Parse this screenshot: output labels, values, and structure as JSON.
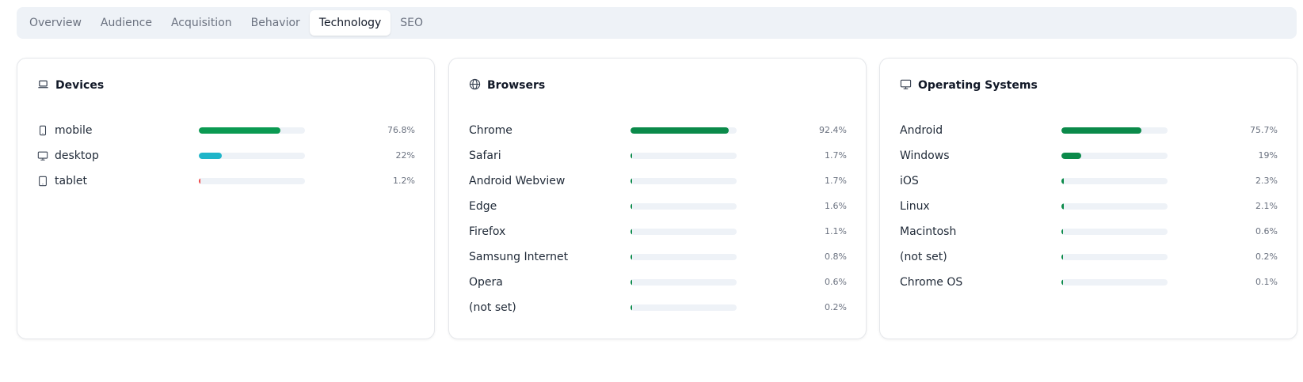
{
  "tabs": [
    {
      "label": "Overview"
    },
    {
      "label": "Audience"
    },
    {
      "label": "Acquisition"
    },
    {
      "label": "Behavior"
    },
    {
      "label": "Technology",
      "active": true
    },
    {
      "label": "SEO"
    }
  ],
  "colors": {
    "green": "#0b8a4a",
    "teal": "#1fb5c9",
    "red": "#ef4444",
    "track": "#eef2f7"
  },
  "cards": [
    {
      "title": "Devices",
      "icon": "laptop-icon",
      "rows": [
        {
          "label": "mobile",
          "pct": "76.8%",
          "value": 76.8,
          "icon": "smartphone-icon",
          "color": "#0b9a52"
        },
        {
          "label": "desktop",
          "pct": "22%",
          "value": 22,
          "icon": "monitor-icon",
          "color": "#1fb5c9"
        },
        {
          "label": "tablet",
          "pct": "1.2%",
          "value": 1.2,
          "icon": "tablet-icon",
          "color": "#ef4444"
        }
      ]
    },
    {
      "title": "Browsers",
      "icon": "globe-icon",
      "rows": [
        {
          "label": "Chrome",
          "pct": "92.4%",
          "value": 92.4
        },
        {
          "label": "Safari",
          "pct": "1.7%",
          "value": 1.7
        },
        {
          "label": "Android Webview",
          "pct": "1.7%",
          "value": 1.7
        },
        {
          "label": "Edge",
          "pct": "1.6%",
          "value": 1.6
        },
        {
          "label": "Firefox",
          "pct": "1.1%",
          "value": 1.1
        },
        {
          "label": "Samsung Internet",
          "pct": "0.8%",
          "value": 0.8
        },
        {
          "label": "Opera",
          "pct": "0.6%",
          "value": 0.6
        },
        {
          "label": "(not set)",
          "pct": "0.2%",
          "value": 0.2
        }
      ]
    },
    {
      "title": "Operating Systems",
      "icon": "monitor-icon",
      "rows": [
        {
          "label": "Android",
          "pct": "75.7%",
          "value": 75.7
        },
        {
          "label": "Windows",
          "pct": "19%",
          "value": 19
        },
        {
          "label": "iOS",
          "pct": "2.3%",
          "value": 2.3
        },
        {
          "label": "Linux",
          "pct": "2.1%",
          "value": 2.1
        },
        {
          "label": "Macintosh",
          "pct": "0.6%",
          "value": 0.6
        },
        {
          "label": "(not set)",
          "pct": "0.2%",
          "value": 0.2
        },
        {
          "label": "Chrome OS",
          "pct": "0.1%",
          "value": 0.1
        }
      ]
    }
  ]
}
